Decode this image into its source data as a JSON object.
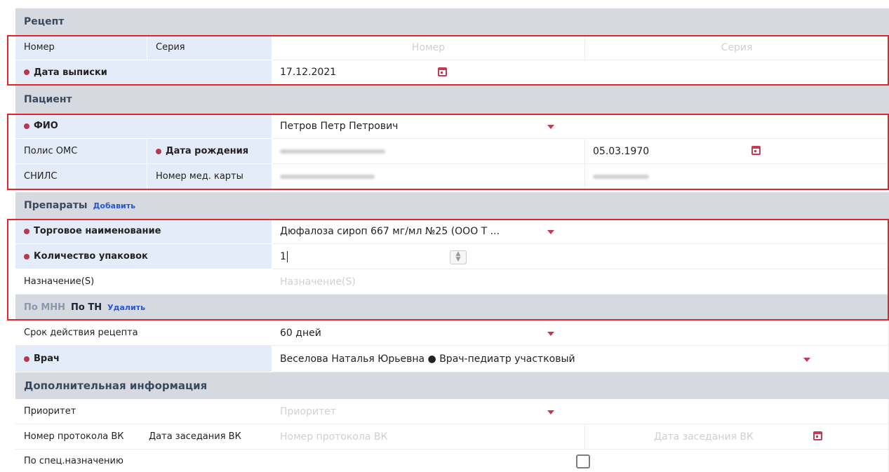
{
  "recipe": {
    "title": "Рецепт",
    "number_label": "Номер",
    "series_label": "Серия",
    "number_placeholder": "Номер",
    "series_placeholder": "Серия",
    "issue_date_label": "Дата выписки",
    "issue_date_value": "17.12.2021"
  },
  "patient": {
    "title": "Пациент",
    "fio_label": "ФИО",
    "fio_value": "Петров Петр Петрович",
    "oms_label": "Полис ОМС",
    "birth_label": "Дата рождения",
    "birth_value": "05.03.1970",
    "snils_label": "СНИЛС",
    "card_label": "Номер мед. карты"
  },
  "drugs": {
    "title": "Препараты",
    "add_link": "Добавить",
    "trade_name_label": "Торговое наименование",
    "trade_name_value": "Дюфалоза сироп 667 мг/мл №25 (ООО Т ...",
    "packages_label": "Количество упаковок",
    "packages_value": "1",
    "purpose_label": "Назначение(S)",
    "purpose_placeholder": "Назначение(S)",
    "tab_mnn": "По МНН",
    "tab_tn": "По ТН",
    "delete_link": "Удалить"
  },
  "validity": {
    "label": "Срок действия рецепта",
    "value": "60 дней"
  },
  "doctor": {
    "label": "Врач",
    "value": "Веселова Наталья Юрьевна ● Врач-педиатр участковый"
  },
  "extra": {
    "title": "Дополнительная информация",
    "priority_label": "Приоритет",
    "priority_placeholder": "Приоритет",
    "protocol_label": "Номер протокола ВК",
    "meeting_label": "Дата заседания ВК",
    "protocol_placeholder": "Номер протокола ВК",
    "meeting_placeholder": "Дата заседания ВК",
    "special_label": "По спец.назначению"
  },
  "colors": {
    "required_dot": "#b43a4d",
    "highlight_border": "#e2262c",
    "section_bg": "#d6d9e0",
    "label_bg": "#e3ecf8",
    "link": "#2a56d6"
  }
}
